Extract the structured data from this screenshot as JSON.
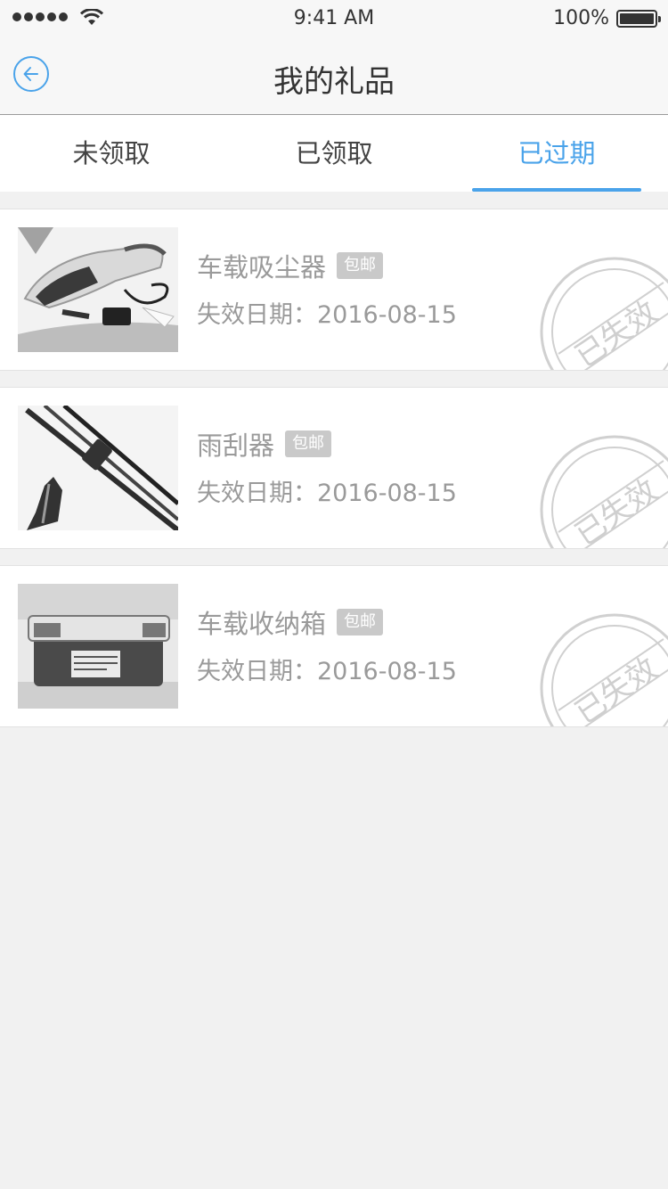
{
  "status_bar": {
    "time": "9:41 AM",
    "battery": "100%"
  },
  "nav": {
    "title": "我的礼品",
    "back_icon": "back-arrow-icon"
  },
  "tabs": [
    {
      "label": "未领取",
      "active": false
    },
    {
      "label": "已领取",
      "active": false
    },
    {
      "label": "已过期",
      "active": true
    }
  ],
  "accent_color": "#4aa3ea",
  "gifts": [
    {
      "name": "车载吸尘器",
      "badge": "包邮",
      "expiry": "失效日期：2016-08-15",
      "stamp": "已失效",
      "image": "car-vacuum-image"
    },
    {
      "name": "雨刮器",
      "badge": "包邮",
      "expiry": "失效日期：2016-08-15",
      "stamp": "已失效",
      "image": "wiper-blade-image"
    },
    {
      "name": "车载收纳箱",
      "badge": "包邮",
      "expiry": "失效日期：2016-08-15",
      "stamp": "已失效",
      "image": "storage-box-image"
    }
  ]
}
